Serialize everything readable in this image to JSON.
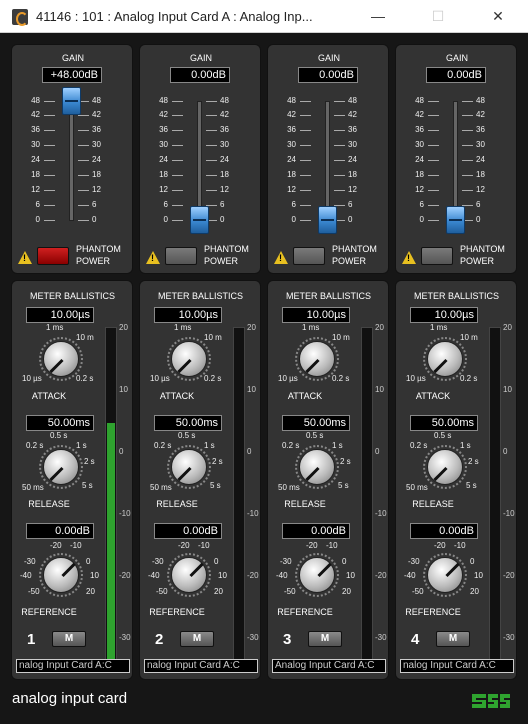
{
  "window": {
    "title": "41146 : 101 : Analog Input Card A : Analog Inp...",
    "min": "—",
    "max": "☐",
    "close": "✕"
  },
  "gain_ticks": [
    "48",
    "42",
    "36",
    "30",
    "24",
    "18",
    "12",
    "6",
    "0"
  ],
  "ballistics": {
    "header": "METER BALLISTICS",
    "attack_label": "ATTACK",
    "attack_scale": {
      "min": "10 µs",
      "max": "0.2 s",
      "a": "1 ms",
      "b": "10 m"
    },
    "release_label": "RELEASE",
    "release_scale": {
      "min": "50 ms",
      "max": "5 s",
      "a": "0.5 s",
      "b": "0.2 s",
      "c": "1 s",
      "d": "2 s"
    },
    "reference_label": "REFERENCE",
    "reference_scale": [
      "-30",
      "-20",
      "-10",
      "0",
      "10",
      "20",
      "-40",
      "-50"
    ]
  },
  "meter_scale": [
    "20",
    "10",
    "0",
    "-10",
    "-20",
    "-30"
  ],
  "channels": [
    {
      "num": "1",
      "gain": "+48.00dB",
      "gain_level": 1.0,
      "phantom_label1": "PHANTOM",
      "phantom_label2": "POWER",
      "phantom_on": true,
      "attack": "10.00µs",
      "release": "50.00ms",
      "reference": "0.00dB",
      "meter_level": 0.72,
      "mute": "M",
      "name": "nalog Input Card A:C"
    },
    {
      "num": "2",
      "gain": "0.00dB",
      "gain_level": 0.0,
      "phantom_label1": "PHANTOM",
      "phantom_label2": "POWER",
      "phantom_on": false,
      "attack": "10.00µs",
      "release": "50.00ms",
      "reference": "0.00dB",
      "meter_level": 0.0,
      "mute": "M",
      "name": "nalog Input Card A:C"
    },
    {
      "num": "3",
      "gain": "0.00dB",
      "gain_level": 0.0,
      "phantom_label1": "PHANTOM",
      "phantom_label2": "POWER",
      "phantom_on": false,
      "attack": "10.00µs",
      "release": "50.00ms",
      "reference": "0.00dB",
      "meter_level": 0.0,
      "mute": "M",
      "name": "Analog Input Card A:C"
    },
    {
      "num": "4",
      "gain": "0.00dB",
      "gain_level": 0.0,
      "phantom_label1": "PHANTOM",
      "phantom_label2": "POWER",
      "phantom_on": false,
      "attack": "10.00µs",
      "release": "50.00ms",
      "reference": "0.00dB",
      "meter_level": 0.0,
      "mute": "M",
      "name": "nalog Input Card A:C"
    }
  ],
  "labels": {
    "gain": "GAIN"
  },
  "footer": {
    "title": "analog input card"
  },
  "colors": {
    "accent": "#3a87d0",
    "meter": "#2fa32f",
    "phantom_on": "#d02020"
  }
}
